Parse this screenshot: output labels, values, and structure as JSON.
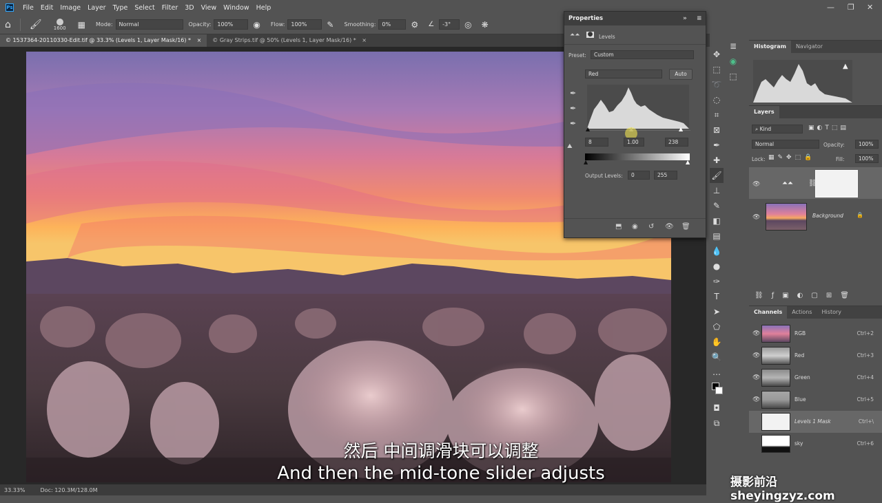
{
  "menubar": {
    "items": [
      "File",
      "Edit",
      "Image",
      "Layer",
      "Type",
      "Select",
      "Filter",
      "3D",
      "View",
      "Window",
      "Help"
    ]
  },
  "options": {
    "brush_size": "1600",
    "mode_label": "Mode:",
    "mode_value": "Normal",
    "opacity_label": "Opacity:",
    "opacity_value": "100%",
    "flow_label": "Flow:",
    "flow_value": "100%",
    "smoothing_label": "Smoothing:",
    "smoothing_value": "0%",
    "angle_value": "-3°"
  },
  "tabs": [
    {
      "label": "© 1537364-20110330-Edit.tif @ 33.3% (Levels 1, Layer Mask/16) *",
      "close": "×"
    },
    {
      "label": "© Gray Strips.tif @ 50% (Levels 1, Layer Mask/16) *",
      "close": "×"
    }
  ],
  "status": {
    "zoom": "33.33%",
    "doc": "Doc: 120.3M/128.0M"
  },
  "subtitles": {
    "cn": "然后 中间调滑块可以调整",
    "en": "And then the mid-tone slider adjusts",
    "watermark": "摄影前沿 sheyingzyz.com"
  },
  "properties": {
    "title": "Properties",
    "collapse": "»",
    "menu": "≡",
    "adjustment_name": "Levels",
    "preset_label": "Preset:",
    "preset_value": "Custom",
    "channel_value": "Red",
    "auto_label": "Auto",
    "input_black": "8",
    "input_mid": "1.00",
    "input_white": "238",
    "output_label": "Output Levels:",
    "output_black": "0",
    "output_white": "255"
  },
  "histogram_panel": {
    "tabs": [
      "Histogram",
      "Navigator"
    ]
  },
  "layers_panel": {
    "tab": "Layers",
    "kind_label": "Kind",
    "blend_mode": "Normal",
    "opacity_label": "Opacity:",
    "opacity_value": "100%",
    "lock_label": "Lock:",
    "fill_label": "Fill:",
    "fill_value": "100%",
    "layers": [
      {
        "name": ""
      },
      {
        "name": "Background"
      }
    ]
  },
  "channels_panel": {
    "tabs": [
      "Channels",
      "Actions",
      "History"
    ],
    "channels": [
      {
        "name": "RGB",
        "shortcut": "Ctrl+2"
      },
      {
        "name": "Red",
        "shortcut": "Ctrl+3"
      },
      {
        "name": "Green",
        "shortcut": "Ctrl+4"
      },
      {
        "name": "Blue",
        "shortcut": "Ctrl+5"
      },
      {
        "name": "Levels 1 Mask",
        "shortcut": "Ctrl+\\"
      },
      {
        "name": "sky",
        "shortcut": "Ctrl+6"
      }
    ]
  }
}
